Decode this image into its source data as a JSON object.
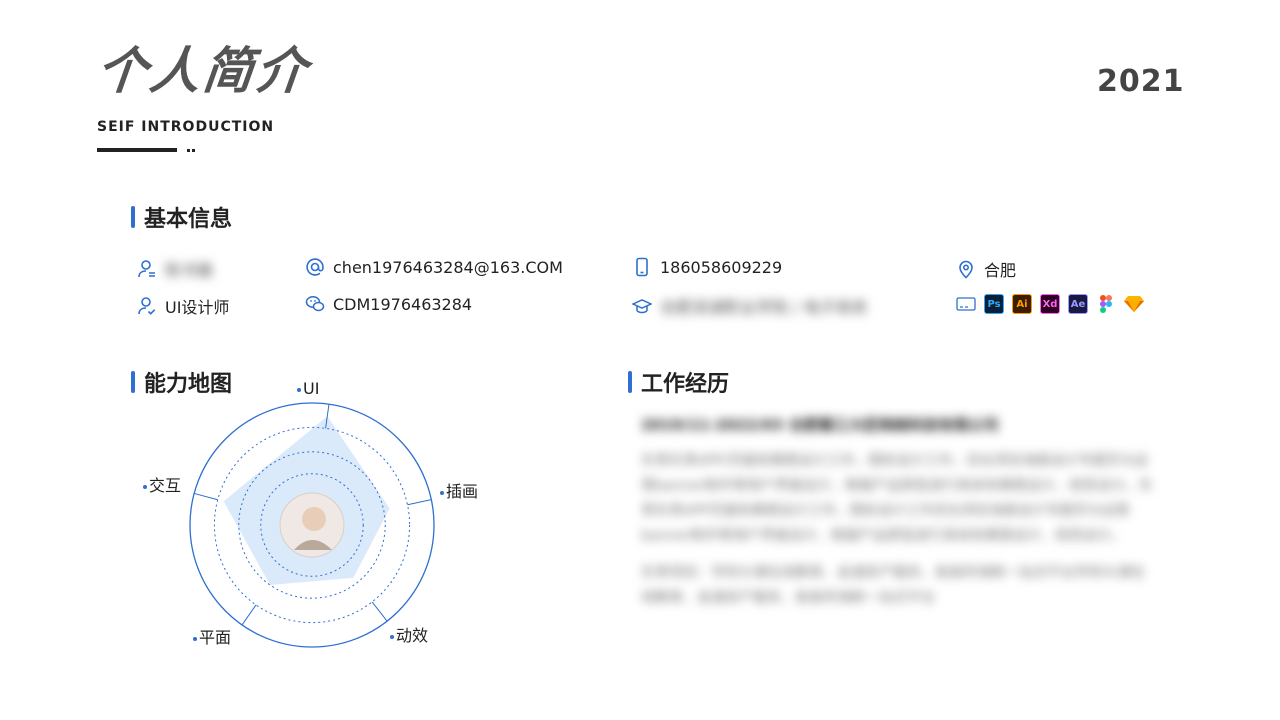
{
  "header": {
    "title": "个人简介",
    "subtitle": "SEIF INTRODUCTION",
    "year": "2021"
  },
  "basic_info": {
    "section_title": "基本信息",
    "name": "陈书雅",
    "email": "chen1976463284@163.COM",
    "phone": "186058609229",
    "city": "合肥",
    "position": "UI设计师",
    "wechat": "CDM1976463284",
    "education": "合肥滨湖职业学院 / 电子商务",
    "tools": [
      {
        "name": "Pr",
        "label": "",
        "bg": "#ffffff",
        "fg": "#2e6fd1"
      },
      {
        "name": "Ps",
        "label": "Ps",
        "bg": "#0b1f33",
        "fg": "#31a8ff"
      },
      {
        "name": "Ai",
        "label": "Ai",
        "bg": "#3a1e03",
        "fg": "#ff9a00"
      },
      {
        "name": "Xd",
        "label": "Xd",
        "bg": "#2e001f",
        "fg": "#ff61f6"
      },
      {
        "name": "Ae",
        "label": "Ae",
        "bg": "#1a1a40",
        "fg": "#9999ff"
      },
      {
        "name": "Figma",
        "label": "",
        "bg": "#ffffff",
        "fg": "#f24e1e"
      },
      {
        "name": "Sketch",
        "label": "",
        "bg": "#ffffff",
        "fg": "#fdb300"
      }
    ]
  },
  "ability": {
    "section_title": "能力地图",
    "axes": [
      "UI",
      "插画",
      "动效",
      "平面",
      "交互"
    ],
    "values": [
      0.9,
      0.65,
      0.55,
      0.6,
      0.75
    ]
  },
  "work": {
    "section_title": "工作经历",
    "entry_head": "2019/11-2022/03  合肥蜀江大匠网络科技有限公司",
    "para1": "负责负责APP/页面效果图设计工作，图标设计工作，优化项目海报设计专题页与运营banner制作等用户界面设计，根据产品原型进行具体效果图设计，视觉设计。负责负责APP页面效果图设计工作，图标设计工作优化项目海报设计专题页与运营banner制作等用户界面设计，根据产品原型进行具体效果图设计，视觉设计。",
    "para2": "负责项目：学府大课在线教育、金渡房产服务、鱼鱼阿海鲜一站式平台学府大课在线教育、金渡房产服务、鱼鱼阿海鲜一站式平台"
  },
  "colors": {
    "accent": "#2e6fd1",
    "radar_fill": "#dbeafb"
  }
}
